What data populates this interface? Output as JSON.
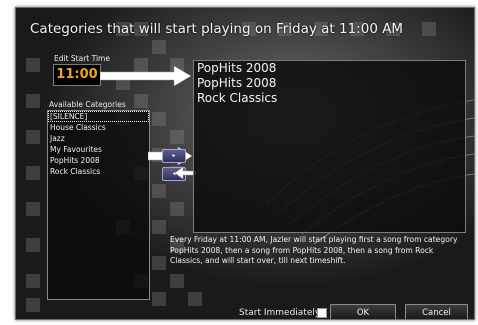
{
  "dialog": {
    "title": "Categories that will start playing on Friday at 11:00 AM",
    "edit_start_time_label": "Edit Start Time",
    "start_time_value": "11:00",
    "available_categories_label": "Available Categories",
    "available_categories": [
      "[SILENCE]",
      "House Classics",
      "Jazz",
      "My Favourites",
      "PopHits 2008",
      "Rock Classics"
    ],
    "selected_category": "[SILENCE]",
    "scheduled_categories": [
      "PopHits 2008",
      "PopHits 2008",
      "Rock Classics"
    ],
    "add_button_glyph": "▸",
    "remove_button_glyph": "◂",
    "description": "Every Friday at 11:00 AM, Jazler will start playing first a song from category PopHits 2008, then a song from PopHits 2008, then a song from Rock Classics, and will start over, till next timeshift.",
    "start_immediately_label": "Start Immediately",
    "start_immediately_checked": false,
    "ok_label": "OK",
    "cancel_label": "Cancel"
  },
  "colors": {
    "time_text": "#f2a418",
    "dialog_background": "#1d1d1d",
    "button_accent": "#2f3060"
  },
  "icons": {
    "annotation_arrow": "white-right-arrow-icon",
    "annotation_arrow_left": "white-left-arrow-icon"
  }
}
